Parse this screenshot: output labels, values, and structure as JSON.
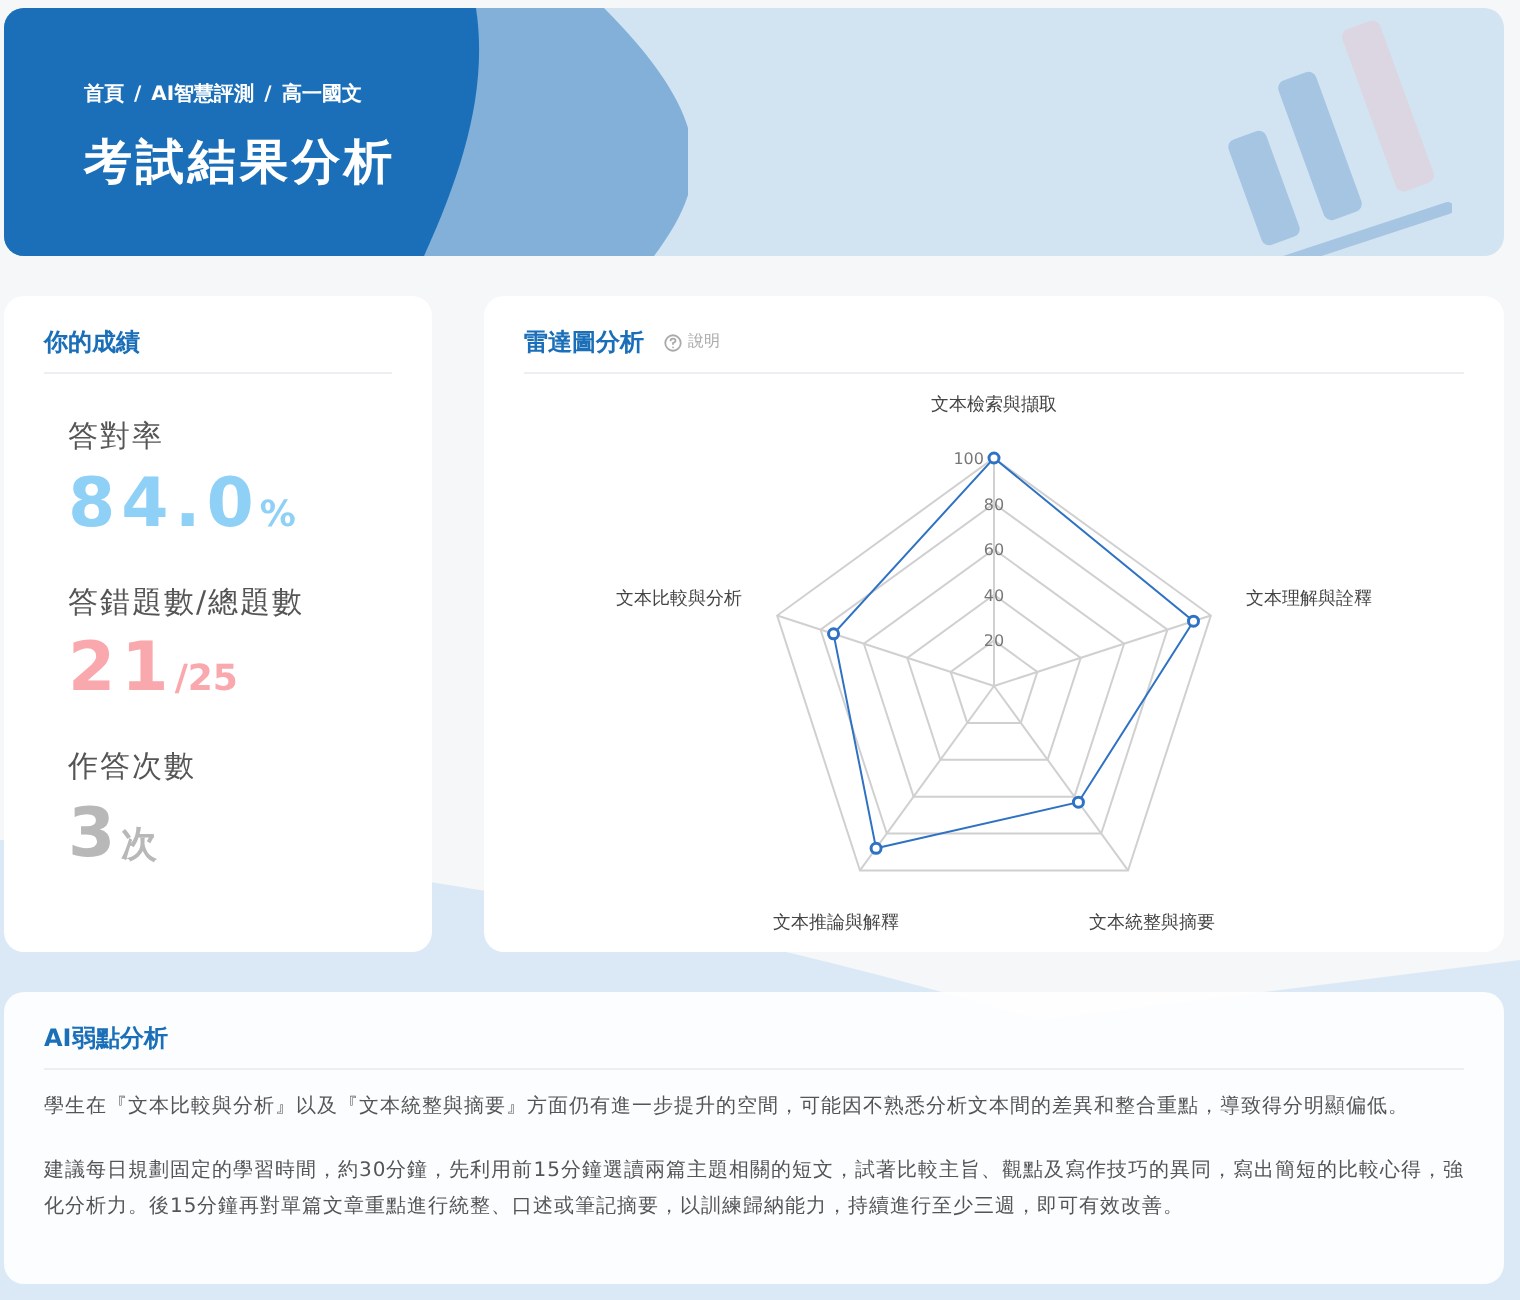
{
  "header": {
    "breadcrumb": [
      "首頁",
      "AI智慧評測",
      "高一國文"
    ],
    "separator": "/",
    "title": "考試結果分析"
  },
  "score_card": {
    "title": "你的成績",
    "stats": [
      {
        "label": "答對率",
        "value": "84.0",
        "unit": "%",
        "color": "#8fd0f7"
      },
      {
        "label": "答錯題數/總題數",
        "value": "21",
        "unit": "/25",
        "color": "#f9a8ad"
      },
      {
        "label": "作答次數",
        "value": "3",
        "unit": "次",
        "color": "#b8b8b8"
      }
    ]
  },
  "radar_card": {
    "title": "雷達圖分析",
    "help": "說明",
    "chart_data": {
      "type": "radar",
      "categories": [
        "文本檢索與擷取",
        "文本理解與詮釋",
        "文本統整與摘要",
        "文本推論與解釋",
        "文本比較與分析"
      ],
      "series": [
        {
          "color": "#2f72c4",
          "values": [
            100,
            92,
            63,
            88,
            74
          ]
        }
      ],
      "ylim": [
        0,
        100
      ],
      "yticks": [
        20,
        40,
        60,
        80,
        100
      ]
    }
  },
  "weakness_card": {
    "title": "AI弱點分析",
    "paragraphs": [
      "學生在『文本比較與分析』以及『文本統整與摘要』方面仍有進一步提升的空間，可能因不熟悉分析文本間的差異和整合重點，導致得分明顯偏低。",
      "建議每日規劃固定的學習時間，約30分鐘，先利用前15分鐘選讀兩篇主題相關的短文，試著比較主旨、觀點及寫作技巧的異同，寫出簡短的比較心得，強化分析力。後15分鐘再對單篇文章重點進行統整、口述或筆記摘要，以訓練歸納能力，持續進行至少三週，即可有效改善。"
    ]
  }
}
